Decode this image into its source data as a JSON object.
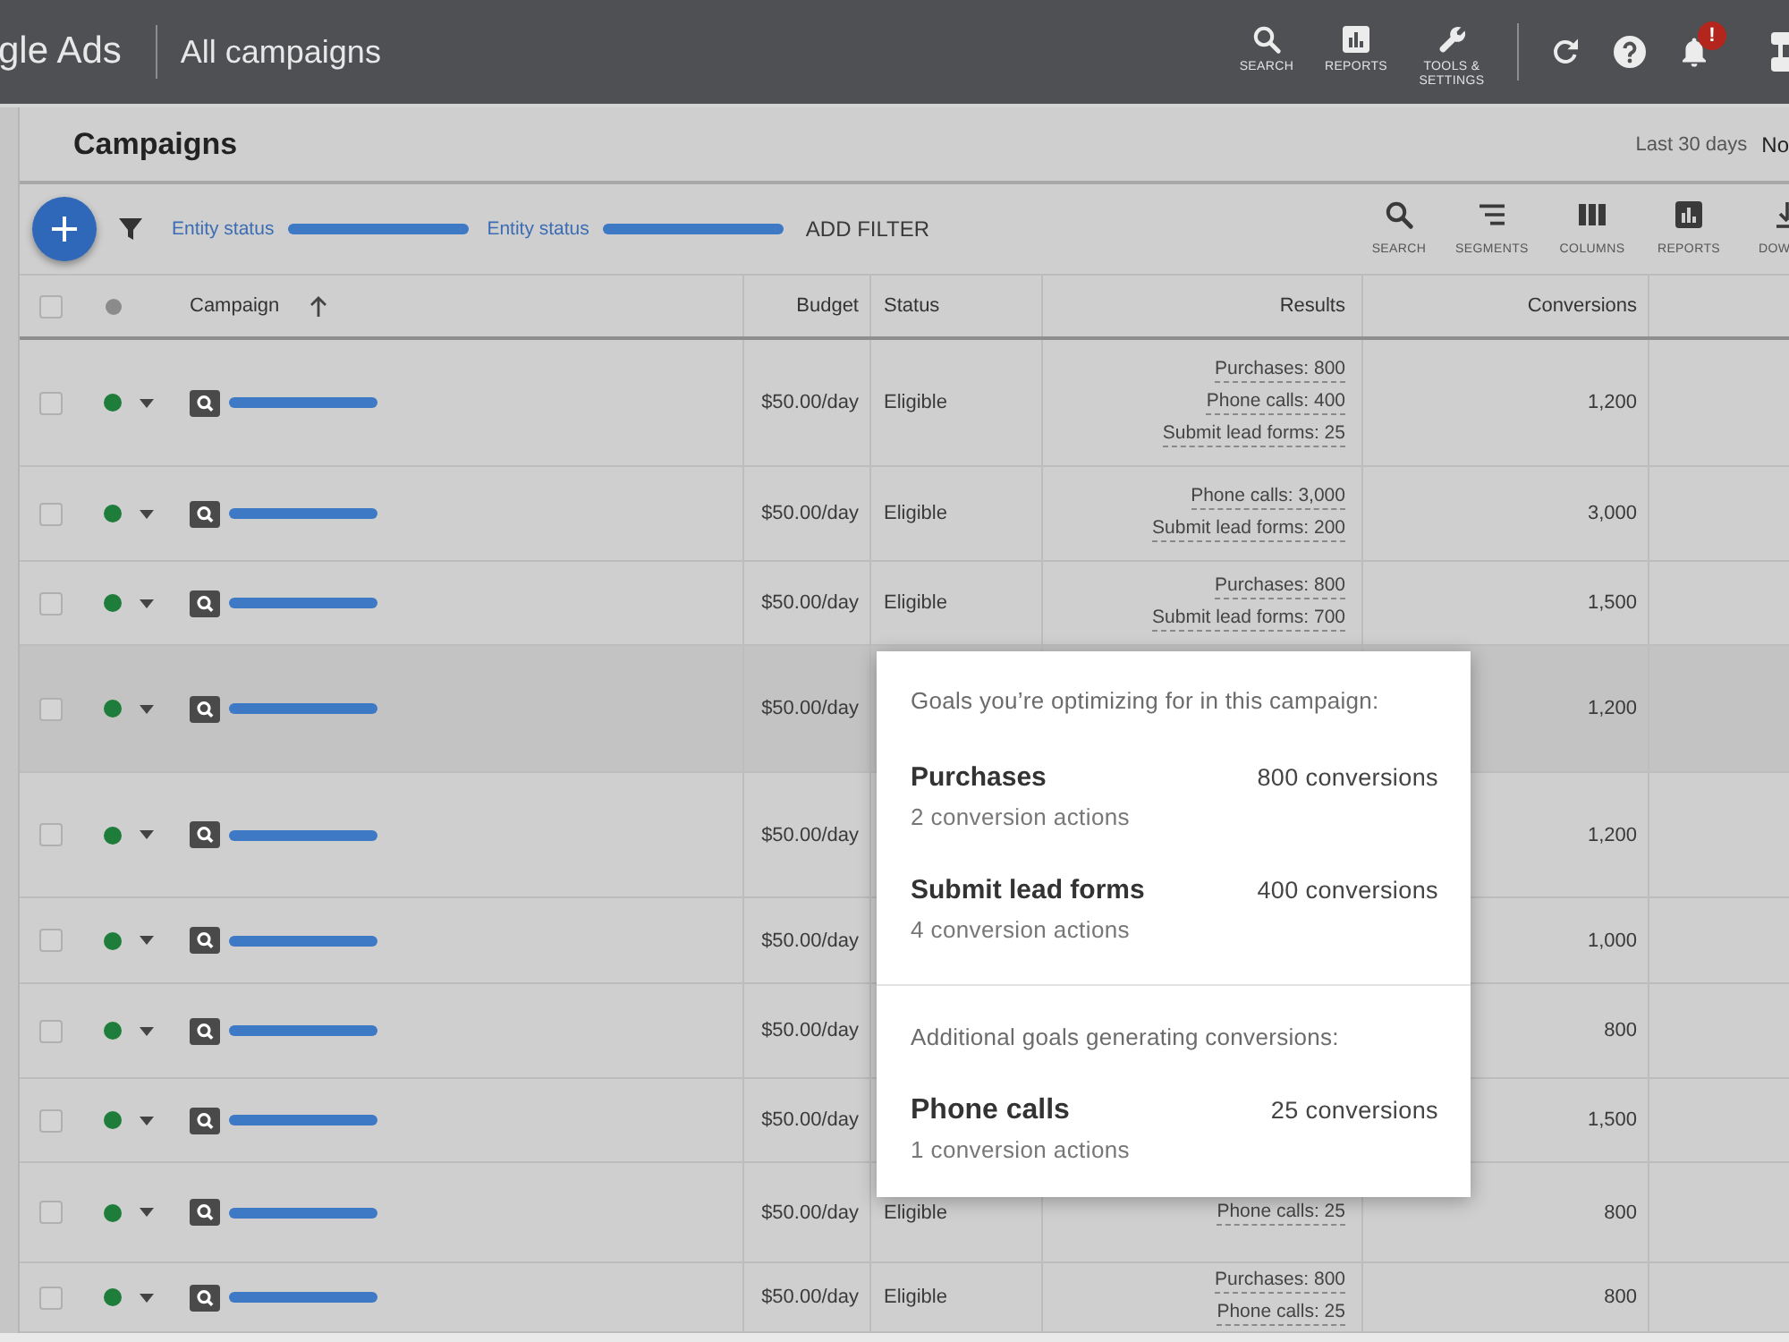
{
  "header": {
    "product_name": "gle Ads",
    "page_title": "All campaigns",
    "tools": [
      {
        "kind": "search",
        "label": "SEARCH"
      },
      {
        "kind": "reports",
        "label": "REPORTS"
      },
      {
        "kind": "tools",
        "label": "TOOLS & SETTINGS"
      }
    ],
    "notification_badge": "!"
  },
  "page_header": {
    "title": "Campaigns",
    "date_range_label": "Last 30 days",
    "date_range_value": "No"
  },
  "filter_bar": {
    "filters": [
      {
        "label": "Entity status"
      },
      {
        "label": "Entity status"
      }
    ],
    "add_filter": "ADD FILTER",
    "tools": [
      {
        "kind": "search",
        "label": "SEARCH"
      },
      {
        "kind": "segments",
        "label": "SEGMENTS"
      },
      {
        "kind": "columns",
        "label": "COLUMNS"
      },
      {
        "kind": "reports",
        "label": "REPORTS"
      },
      {
        "kind": "download",
        "label": "DOW"
      }
    ]
  },
  "table": {
    "columns": [
      {
        "kind": "checkbox",
        "checked": false
      },
      {
        "kind": "status"
      },
      {
        "kind": "text",
        "label": "Campaign",
        "sorted": true
      },
      {
        "kind": "text",
        "label": "Budget",
        "sorted": false
      },
      {
        "kind": "text",
        "label": "Status",
        "sorted": false
      },
      {
        "kind": "text",
        "label": "Results",
        "sorted": false
      },
      {
        "kind": "text",
        "label": "Conversions",
        "sorted": false
      }
    ],
    "rows": [
      {
        "checked": false,
        "enabled": true,
        "highlighted": false,
        "budget": "$50.00/day",
        "status": "Eligible",
        "results": [
          "Purchases: 800",
          "Phone calls: 400",
          "Submit lead forms: 25"
        ],
        "conversions": "1,200"
      },
      {
        "checked": false,
        "enabled": true,
        "highlighted": false,
        "budget": "$50.00/day",
        "status": "Eligible",
        "results": [
          "Phone calls: 3,000",
          "Submit lead forms: 200"
        ],
        "conversions": "3,000"
      },
      {
        "checked": false,
        "enabled": true,
        "highlighted": false,
        "budget": "$50.00/day",
        "status": "Eligible",
        "results": [
          "Purchases: 800",
          "Submit lead forms: 700"
        ],
        "conversions": "1,500"
      },
      {
        "checked": false,
        "enabled": true,
        "highlighted": true,
        "budget": "$50.00/day",
        "conversions": "1,200"
      },
      {
        "checked": false,
        "enabled": true,
        "highlighted": false,
        "budget": "$50.00/day",
        "conversions": "1,200"
      },
      {
        "checked": false,
        "enabled": true,
        "highlighted": false,
        "budget": "$50.00/day",
        "conversions": "1,000"
      },
      {
        "checked": false,
        "enabled": true,
        "highlighted": false,
        "budget": "$50.00/day",
        "conversions": "800"
      },
      {
        "checked": false,
        "enabled": true,
        "highlighted": false,
        "budget": "$50.00/day",
        "conversions": "1,500"
      },
      {
        "checked": false,
        "enabled": true,
        "highlighted": false,
        "budget": "$50.00/day",
        "status": "Eligible",
        "results": [
          "Phone calls: 25"
        ],
        "conversions": "800"
      },
      {
        "checked": false,
        "enabled": true,
        "highlighted": false,
        "budget": "$50.00/day",
        "status": "Eligible",
        "results": [
          "Purchases: 800",
          "Phone calls: 25"
        ],
        "conversions": "800"
      }
    ]
  },
  "goals_popup": {
    "heading": "Goals you’re optimizing for in this campaign:",
    "goals": [
      {
        "name": "Purchases",
        "conversions": "800 conversions",
        "actions": "2 conversion actions"
      },
      {
        "name": "Submit lead forms",
        "conversions": "400 conversions",
        "actions": "4 conversion actions"
      }
    ],
    "additional_heading": "Additional goals generating conversions:",
    "additional_goals": [
      {
        "name": "Phone calls",
        "conversions": "25 conversions",
        "actions": "1 conversion actions"
      }
    ]
  }
}
